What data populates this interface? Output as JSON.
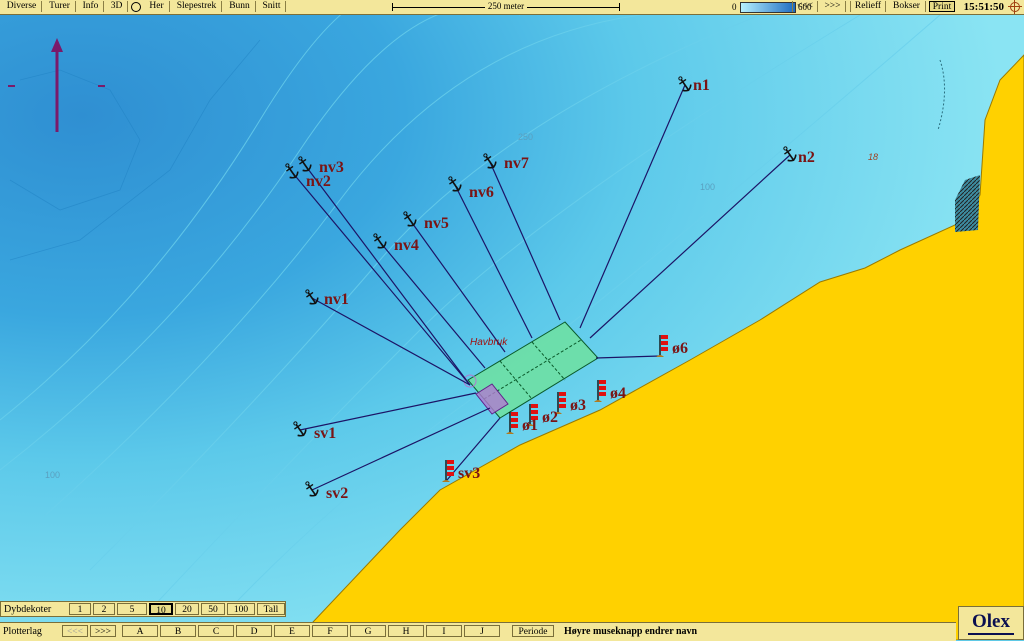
{
  "topbar": {
    "menu": [
      "Diverse",
      "Turer",
      "Info",
      "3D",
      "Her",
      "Slepestrek",
      "Bunn",
      "Snitt"
    ],
    "scale_label": "250 meter",
    "depth_min": "0",
    "depth_max": "600",
    "prev": "<<<",
    "next": ">>>",
    "right_buttons": [
      "Relieff",
      "Bokser",
      "Print"
    ],
    "clock": "15:51:50"
  },
  "map": {
    "farm_label": "Havbruk",
    "depth_labels": [
      "250",
      "100",
      "100",
      "18"
    ],
    "anchors": [
      {
        "label": "n1"
      },
      {
        "label": "n2"
      },
      {
        "label": "nv3"
      },
      {
        "label": "nv2"
      },
      {
        "label": "nv7"
      },
      {
        "label": "nv6"
      },
      {
        "label": "nv5"
      },
      {
        "label": "nv4"
      },
      {
        "label": "nv1"
      },
      {
        "label": "sv1"
      },
      {
        "label": "sv2"
      }
    ],
    "flags": [
      {
        "label": "ø6"
      },
      {
        "label": "ø4"
      },
      {
        "label": "ø3"
      },
      {
        "label": "ø2"
      },
      {
        "label": "ø1"
      },
      {
        "label": "sv3"
      }
    ],
    "colors": {
      "land": "#ffd100",
      "shallow": "#7fdcf0",
      "deep": "#2f8fd2",
      "lines": "#1c1466",
      "labels": "#7a1414",
      "farm": "#6fe0a0"
    }
  },
  "dybdekoter": {
    "label": "Dybdekoter",
    "options": [
      "1",
      "2",
      "5",
      "10",
      "20",
      "50",
      "100",
      "Tall"
    ],
    "selected": "10"
  },
  "bottombar": {
    "label": "Plotterlag",
    "prev": "<<<",
    "next": ">>>",
    "layers": [
      "A",
      "B",
      "C",
      "D",
      "E",
      "F",
      "G",
      "H",
      "I",
      "J"
    ],
    "periode": "Periode",
    "hint": "Høyre museknapp endrer navn"
  },
  "brand": "Olex"
}
